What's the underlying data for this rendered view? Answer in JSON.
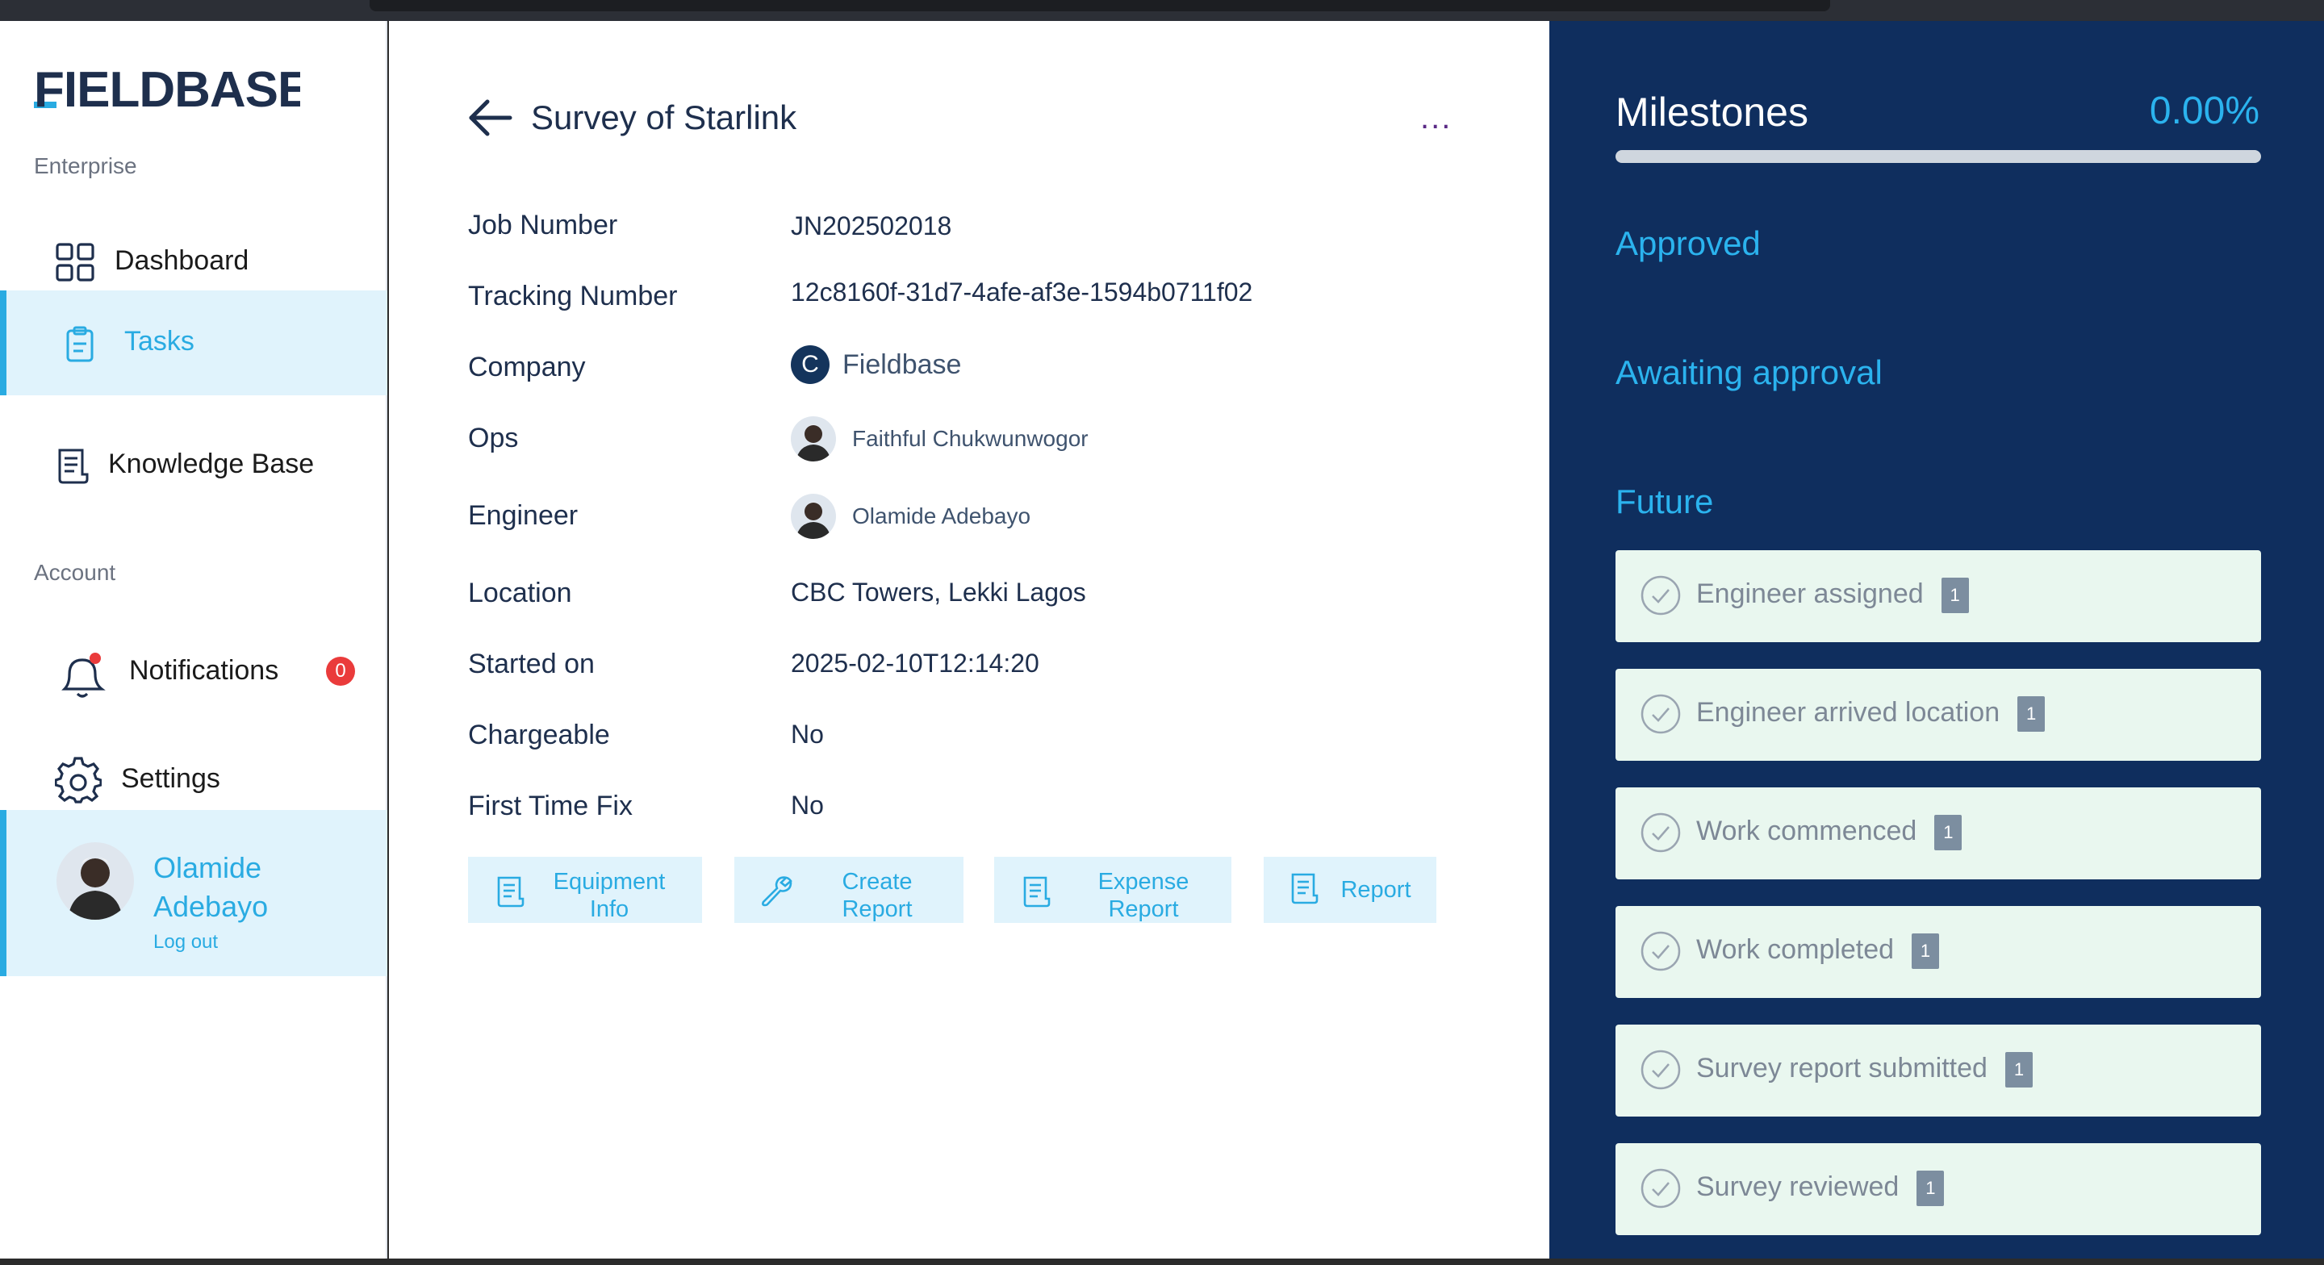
{
  "app": {
    "brand": "FIELDBASE",
    "brand_colors": {
      "accent": "#29abe2",
      "navy": "#0f2e5e",
      "danger": "#ea3b3b"
    }
  },
  "sidebar": {
    "enterprise_label": "Enterprise",
    "account_label": "Account",
    "items": {
      "dashboard": {
        "label": "Dashboard",
        "icon": "grid-icon"
      },
      "tasks": {
        "label": "Tasks",
        "icon": "clipboard-icon"
      },
      "knowledge": {
        "label": "Knowledge Base",
        "icon": "document-icon"
      },
      "notifications": {
        "label": "Notifications",
        "icon": "bell-icon",
        "count": "0"
      },
      "settings": {
        "label": "Settings",
        "icon": "gear-icon"
      }
    },
    "user": {
      "name": "Olamide Adebayo",
      "logout": "Log out"
    }
  },
  "main": {
    "title": "Survey of Starlink",
    "more_label": "...",
    "rows": {
      "job_number": {
        "label": "Job Number",
        "value": "JN202502018"
      },
      "tracking_number": {
        "label": "Tracking Number",
        "value": "12c8160f-31d7-4afe-af3e-1594b0711f02"
      },
      "company": {
        "label": "Company",
        "value": "Fieldbase",
        "initial": "C"
      },
      "ops": {
        "label": "Ops",
        "value": "Faithful Chukwunwogor"
      },
      "engineer": {
        "label": "Engineer",
        "value": "Olamide Adebayo"
      },
      "location": {
        "label": "Location",
        "value": "CBC Towers, Lekki Lagos"
      },
      "started_on": {
        "label": "Started on",
        "value": "2025-02-10T12:14:20"
      },
      "chargeable": {
        "label": "Chargeable",
        "value": "No"
      },
      "first_time_fix": {
        "label": "First Time Fix",
        "value": "No"
      }
    },
    "actions": {
      "equipment": {
        "line1": "Equipment",
        "line2": "Info",
        "icon": "document-icon"
      },
      "create_report": {
        "line1": "Create",
        "line2": "Report",
        "icon": "wrench-icon"
      },
      "expense": {
        "line1": "Expense",
        "line2": "Report",
        "icon": "document-icon"
      },
      "report": {
        "line1": "Report",
        "icon": "document-icon"
      }
    }
  },
  "milestones": {
    "title": "Milestones",
    "percent": "0.00%",
    "progress": 0,
    "approved_label": "Approved",
    "awaiting_label": "Awaiting approval",
    "future_label": "Future",
    "future_items": [
      {
        "label": "Engineer assigned",
        "count": "1"
      },
      {
        "label": "Engineer arrived location",
        "count": "1"
      },
      {
        "label": "Work commenced",
        "count": "1"
      },
      {
        "label": "Work completed",
        "count": "1"
      },
      {
        "label": "Survey report submitted",
        "count": "1"
      },
      {
        "label": "Survey reviewed",
        "count": "1"
      }
    ]
  }
}
